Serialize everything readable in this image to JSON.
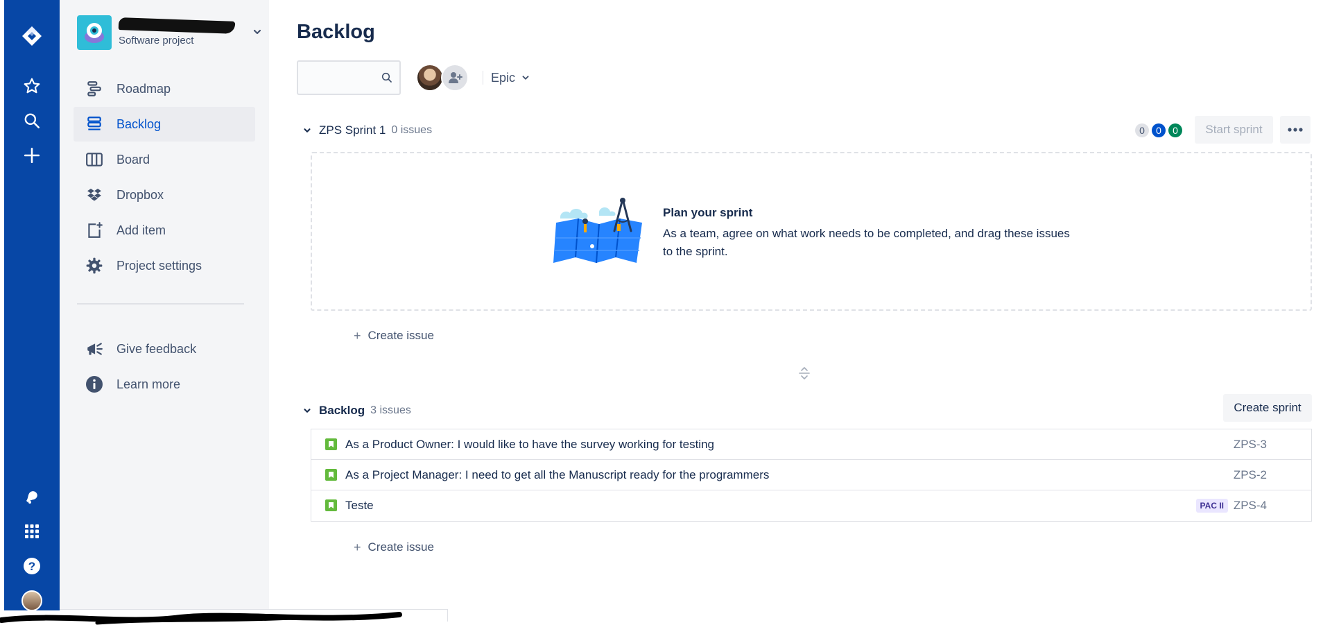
{
  "global_nav": {
    "items": [
      {
        "icon": "jira-logo-icon"
      },
      {
        "icon": "star-icon"
      },
      {
        "icon": "search-icon"
      },
      {
        "icon": "plus-icon"
      },
      {
        "icon": "notifications-icon"
      },
      {
        "icon": "app-switcher-icon"
      },
      {
        "icon": "help-icon"
      },
      {
        "icon": "profile-avatar"
      }
    ]
  },
  "project": {
    "type": "Software project"
  },
  "sidebar": {
    "items": [
      {
        "label": "Roadmap",
        "icon": "roadmap-icon"
      },
      {
        "label": "Backlog",
        "icon": "backlog-icon",
        "selected": true
      },
      {
        "label": "Board",
        "icon": "board-icon"
      },
      {
        "label": "Dropbox",
        "icon": "dropbox-icon"
      },
      {
        "label": "Add item",
        "icon": "add-item-icon"
      },
      {
        "label": "Project settings",
        "icon": "gear-icon"
      }
    ],
    "footer": [
      {
        "label": "Give feedback",
        "icon": "megaphone-icon"
      },
      {
        "label": "Learn more",
        "icon": "info-icon"
      }
    ]
  },
  "main": {
    "title": "Backlog",
    "search": {
      "value": "",
      "placeholder": ""
    },
    "epic_filter": "Epic",
    "colors": {
      "accent": "#0052cc",
      "nav": "#0747a6",
      "story": "#63ba3c"
    }
  },
  "sprint": {
    "name": "ZPS Sprint 1",
    "count": "0 issues",
    "badges": [
      "0",
      "0",
      "0"
    ],
    "start_label": "Start sprint",
    "empty_title": "Plan your sprint",
    "empty_text": "As a team, agree on what work needs to be completed, and drag these issues to the sprint.",
    "create_issue": "Create issue"
  },
  "backlog": {
    "name": "Backlog",
    "count": "3 issues",
    "create_sprint": "Create sprint",
    "create_issue": "Create issue",
    "issues": [
      {
        "summary": "As a Product Owner: I would like to have the survey working for testing",
        "key": "ZPS-3",
        "epic": ""
      },
      {
        "summary": "As a Project Manager: I need to get all the Manuscript ready for the programmers",
        "key": "ZPS-2",
        "epic": ""
      },
      {
        "summary": "Teste",
        "key": "ZPS-4",
        "epic": "PAC II"
      }
    ]
  }
}
